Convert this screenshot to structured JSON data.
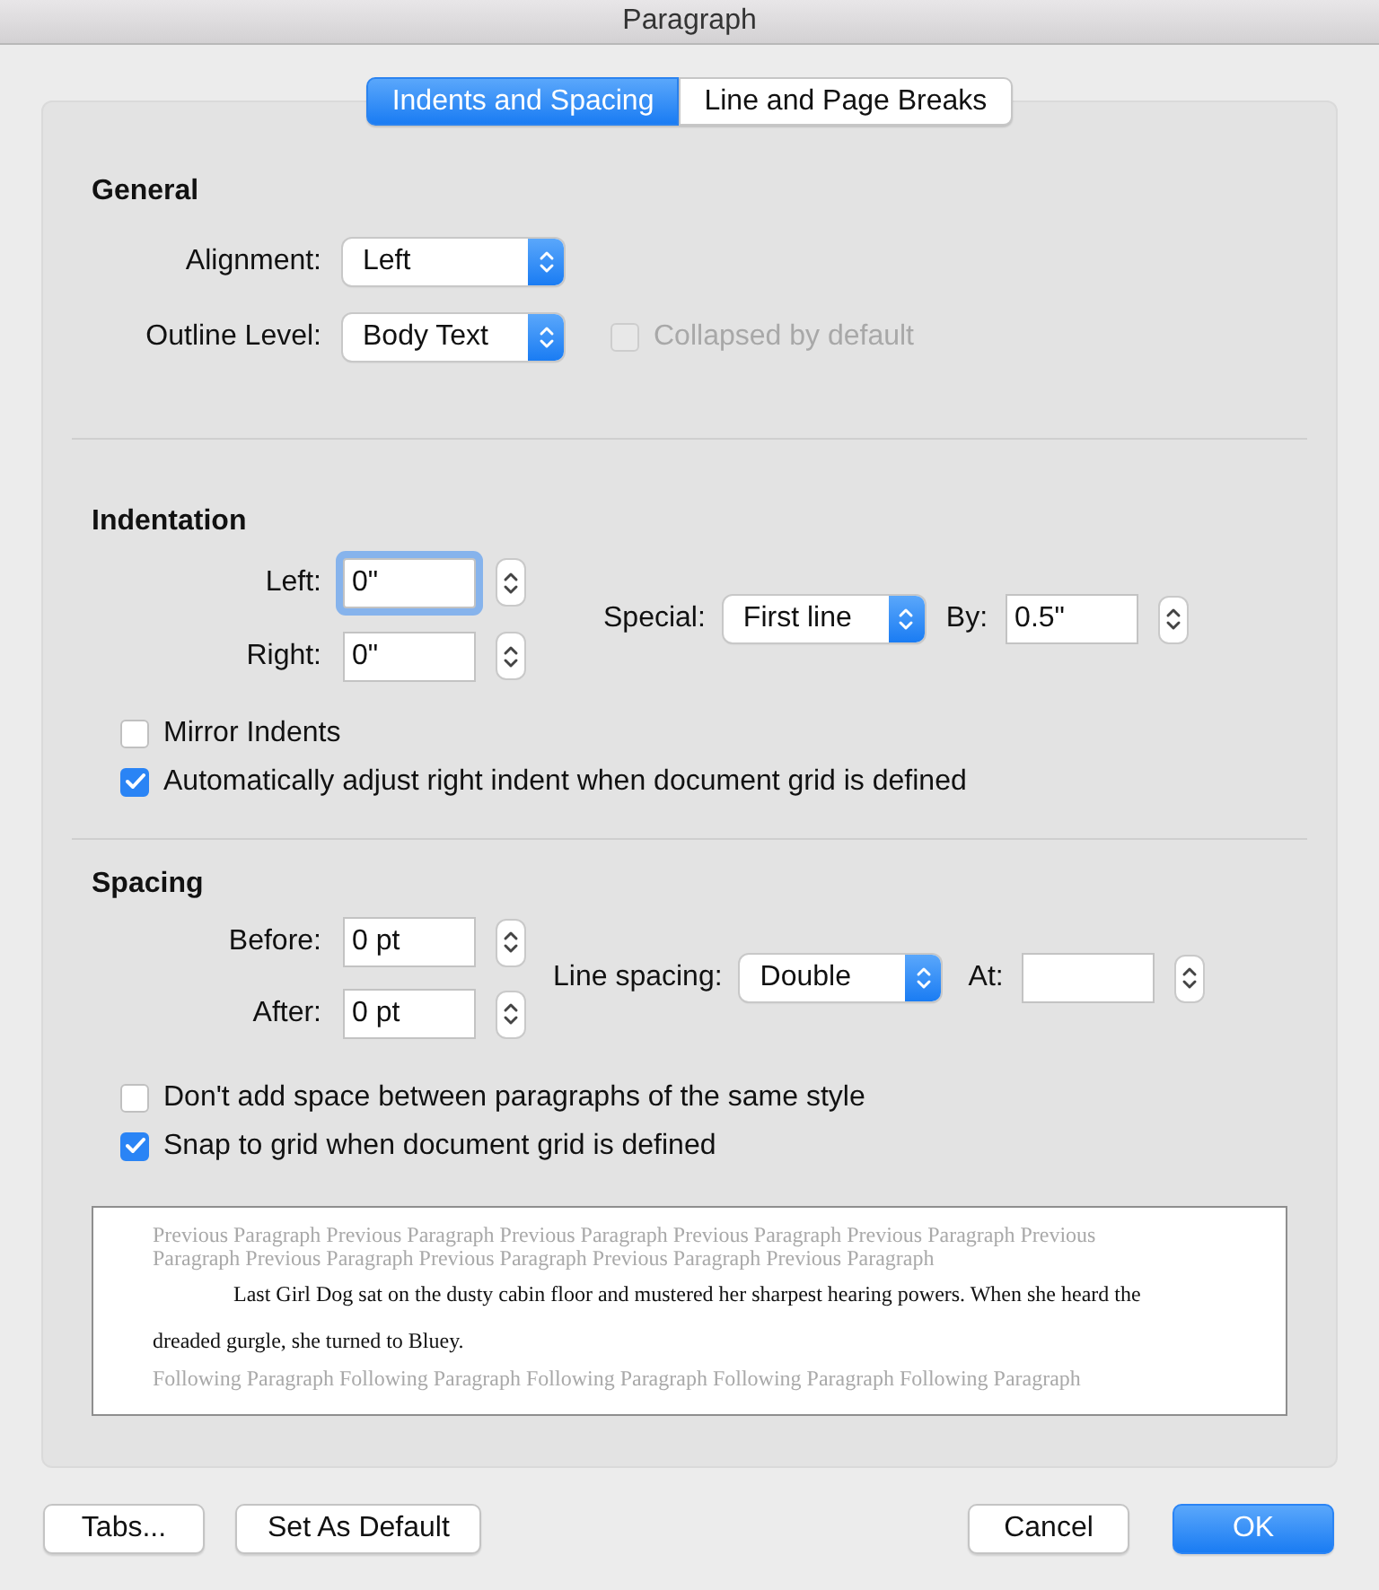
{
  "window": {
    "title": "Paragraph"
  },
  "tabs": [
    {
      "label": "Indents and Spacing",
      "selected": true
    },
    {
      "label": "Line and Page Breaks",
      "selected": false
    }
  ],
  "general": {
    "heading": "General",
    "alignment": {
      "label": "Alignment:",
      "value": "Left"
    },
    "outline_level": {
      "label": "Outline Level:",
      "value": "Body Text"
    },
    "collapsed": {
      "label": "Collapsed by default",
      "checked": false,
      "disabled": true
    }
  },
  "indentation": {
    "heading": "Indentation",
    "left": {
      "label": "Left:",
      "value": "0\"",
      "focused": true
    },
    "right": {
      "label": "Right:",
      "value": "0\"",
      "focused": false
    },
    "special": {
      "label": "Special:",
      "value": "First line"
    },
    "by": {
      "label": "By:",
      "value": "0.5\"",
      "focused": false
    },
    "checkboxes": [
      {
        "label": "Mirror Indents",
        "checked": false
      },
      {
        "label": "Automatically adjust right indent when document grid is defined",
        "checked": true
      }
    ]
  },
  "spacing": {
    "heading": "Spacing",
    "before": {
      "label": "Before:",
      "value": "0 pt",
      "focused": false
    },
    "after": {
      "label": "After:",
      "value": "0 pt",
      "focused": false
    },
    "line_spacing": {
      "label": "Line spacing:",
      "value": "Double"
    },
    "at": {
      "label": "At:",
      "focused": false
    },
    "checkboxes": [
      {
        "label": "Don't add space between paragraphs of the same style",
        "checked": false
      },
      {
        "label": "Snap to grid when document grid is defined",
        "checked": true
      }
    ]
  },
  "preview": {
    "previous": "Previous Paragraph Previous Paragraph Previous Paragraph Previous Paragraph Previous Paragraph Previous Paragraph Previous Paragraph Previous Paragraph Previous Paragraph Previous Paragraph",
    "current": "Last Girl Dog sat on the dusty cabin floor and mustered her sharpest hearing powers. When she heard the dreaded gurgle, she turned to Bluey.",
    "following": "Following Paragraph Following Paragraph Following Paragraph Following Paragraph Following Paragraph"
  },
  "buttons_left": [
    {
      "label": "Tabs...",
      "kind": "normal"
    },
    {
      "label": "Set As Default",
      "kind": "normal"
    }
  ],
  "buttons_right": [
    {
      "label": "Cancel",
      "kind": "normal"
    },
    {
      "label": "OK",
      "kind": "default"
    }
  ]
}
